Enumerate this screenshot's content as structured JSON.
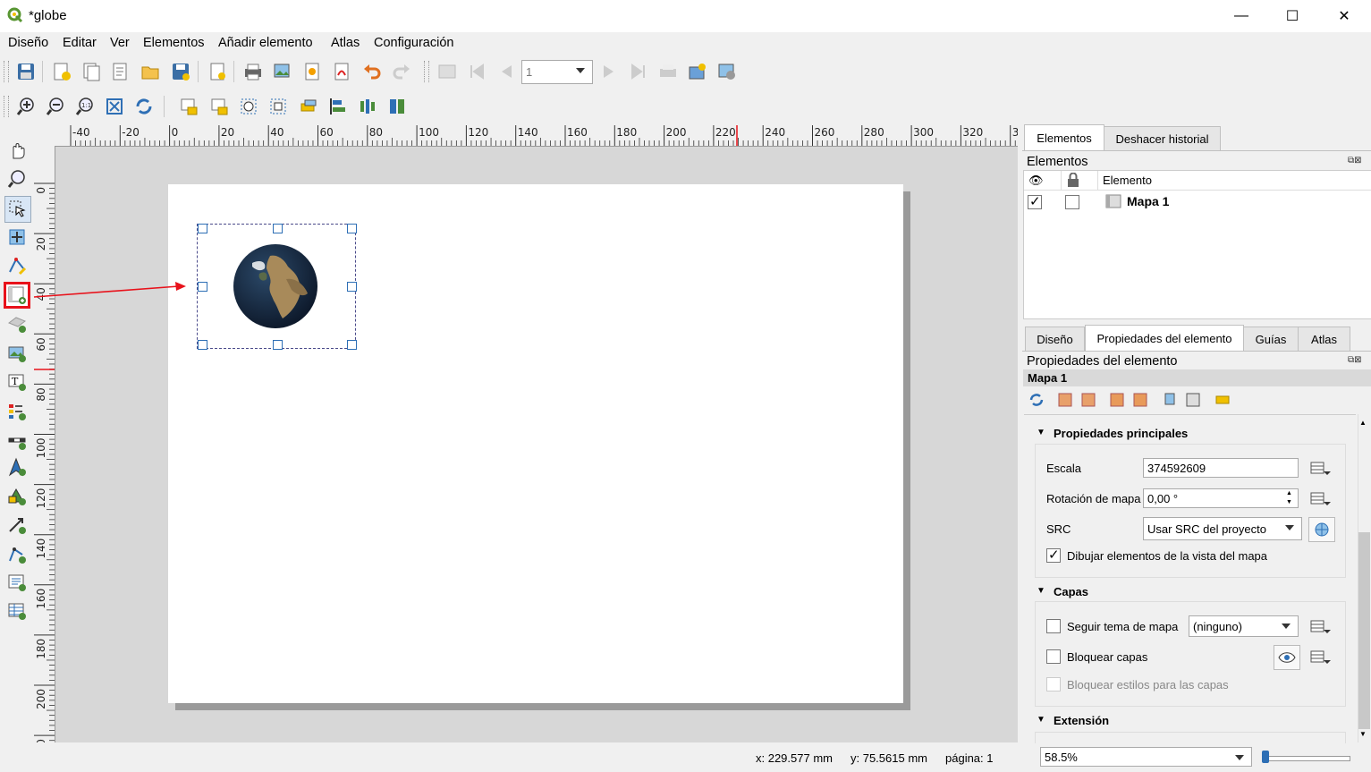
{
  "window": {
    "title": "*globe"
  },
  "menu": [
    "Diseño",
    "Editar",
    "Ver",
    "Elementos",
    "Añadir elemento",
    "Atlas",
    "Configuración"
  ],
  "toolbar": {
    "page_number": "1"
  },
  "ruler": {
    "h_labels": [
      "-40",
      "-20",
      "0",
      "20",
      "40",
      "60",
      "80",
      "100",
      "120",
      "140",
      "160",
      "180",
      "200",
      "220",
      "240",
      "260",
      "280",
      "300",
      "320",
      "3"
    ],
    "v_labels": [
      "0",
      "20",
      "40",
      "60",
      "80",
      "100",
      "120",
      "140",
      "160",
      "180",
      "200",
      "20"
    ]
  },
  "items_panel": {
    "tabs": [
      "Elementos",
      "Deshacer historial"
    ],
    "title": "Elementos",
    "column": "Elemento",
    "rows": [
      {
        "visible": true,
        "locked": false,
        "name": "Mapa 1"
      }
    ]
  },
  "props_tabs": [
    "Diseño",
    "Propiedades del elemento",
    "Guías",
    "Atlas"
  ],
  "props": {
    "title": "Propiedades del elemento",
    "item_name": "Mapa 1",
    "main_group": "Propiedades principales",
    "scale_label": "Escala",
    "scale_value": "374592609",
    "rotation_label": "Rotación de mapa",
    "rotation_value": "0,00 °",
    "src_label": "SRC",
    "src_value": "Usar SRC del proyecto",
    "draw_overview_label": "Dibujar elementos de la vista del mapa",
    "draw_overview_checked": true,
    "layers_group": "Capas",
    "follow_theme_label": "Seguir tema de mapa",
    "follow_theme_value": "(ninguno)",
    "lock_layers_label": "Bloquear capas",
    "lock_styles_label": "Bloquear estilos para las capas",
    "extent_group": "Extensión"
  },
  "status": {
    "x": "x: 229.577 mm",
    "y": "y: 75.5615 mm",
    "page": "página: 1",
    "zoom": "58.5%"
  },
  "colors": {
    "highlight": "#e8121b",
    "accent": "#2e6fb5"
  }
}
